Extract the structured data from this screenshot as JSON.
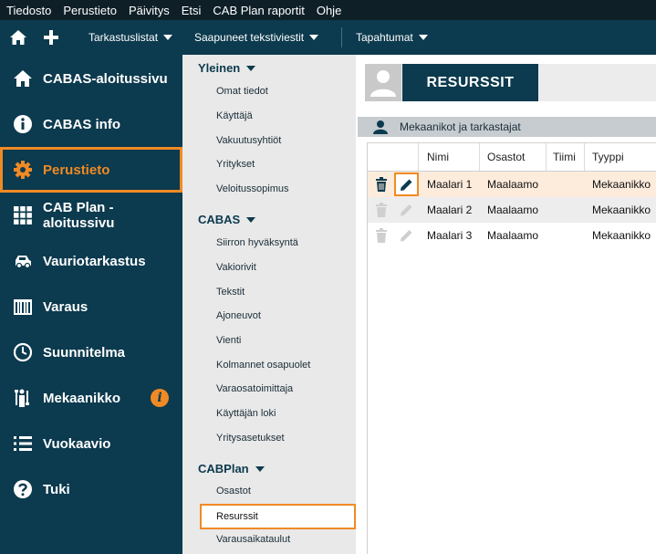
{
  "menubar": {
    "items": [
      "Tiedosto",
      "Perustieto",
      "Päivitys",
      "Etsi",
      "CAB Plan raportit",
      "Ohje"
    ]
  },
  "toolbar": {
    "icons": [
      "home-icon",
      "plus-icon"
    ],
    "menus": [
      "Tarkastuslistat",
      "Saapuneet tekstiviestit",
      "Tapahtumat"
    ]
  },
  "sidebar": {
    "items": [
      {
        "label": "CABAS-aloitussivu",
        "icon": "home-icon"
      },
      {
        "label": "CABAS info",
        "icon": "info-icon"
      },
      {
        "label": "Perustieto",
        "icon": "gear-icon",
        "active": true
      },
      {
        "label": "CAB Plan -aloitussivu",
        "icon": "grid-icon"
      },
      {
        "label": "Vauriotarkastus",
        "icon": "car-icon"
      },
      {
        "label": "Varaus",
        "icon": "calendar-icon"
      },
      {
        "label": "Suunnitelma",
        "icon": "clock-icon"
      },
      {
        "label": "Mekaanikko",
        "icon": "mechanic-icon",
        "badge": "i"
      },
      {
        "label": "Vuokaavio",
        "icon": "list-icon"
      },
      {
        "label": "Tuki",
        "icon": "help-icon"
      }
    ]
  },
  "subnav": {
    "sections": [
      {
        "title": "Yleinen",
        "items": [
          "Omat tiedot",
          "Käyttäjä",
          "Vakuutusyhtiöt",
          "Yritykset",
          "Veloitussopimus"
        ]
      },
      {
        "title": "CABAS",
        "items": [
          "Siirron hyväksyntä",
          "Vakiorivit",
          "Tekstit",
          "Ajoneuvot",
          "Vienti",
          "Kolmannet osapuolet",
          "Varaosatoimittaja",
          "Käyttäjän loki",
          "Yritysasetukset"
        ]
      },
      {
        "title": "CABPlan",
        "items": [
          "Osastot",
          "Resurssit",
          "Varausaikataulut"
        ],
        "active": "Resurssit"
      }
    ]
  },
  "main": {
    "title": "RESURSSIT",
    "section_label": "Mekaanikot ja tarkastajat",
    "table": {
      "columns": [
        "Nimi",
        "Osastot",
        "Tiimi",
        "Tyyppi"
      ],
      "rows": [
        {
          "nimi": "Maalari 1",
          "osastot": "Maalaamo",
          "tiimi": "",
          "tyyppi": "Mekaanikko"
        },
        {
          "nimi": "Maalari 2",
          "osastot": "Maalaamo",
          "tiimi": "",
          "tyyppi": "Mekaanikko"
        },
        {
          "nimi": "Maalari 3",
          "osastot": "Maalaamo",
          "tiimi": "",
          "tyyppi": "Mekaanikko"
        }
      ]
    }
  },
  "colors": {
    "navy": "#0c3a4e",
    "accent": "#f08a24",
    "menubar": "#0e1f28"
  }
}
